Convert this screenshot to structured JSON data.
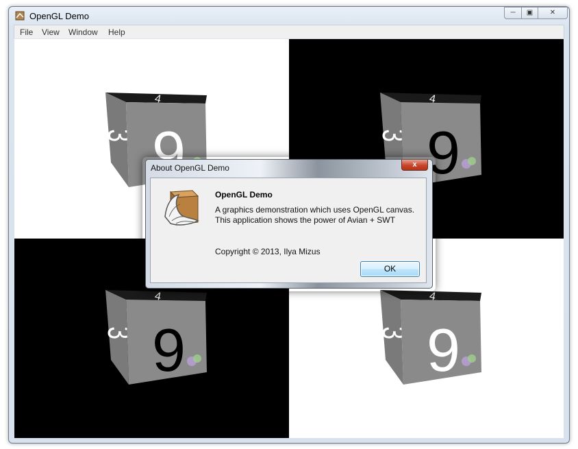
{
  "window": {
    "title": "OpenGL Demo",
    "minimize_glyph": "─",
    "maximize_glyph": "▣",
    "close_glyph": "✕"
  },
  "menu": [
    "File",
    "View",
    "Window",
    "Help"
  ],
  "canvas": {
    "quadrant_colors": [
      "#ffffff",
      "#000000",
      "#000000",
      "#ffffff"
    ],
    "cube_faces": {
      "front": "9",
      "side": "3",
      "top": "4"
    },
    "cube_front_text_colors": [
      "#ffffff",
      "#000000",
      "#000000",
      "#ffffff"
    ]
  },
  "dialog": {
    "title": "About OpenGL Demo",
    "close_glyph": "x",
    "heading": "OpenGL Demo",
    "line1": "A graphics demonstration which uses OpenGL canvas.",
    "line2": "This application shows the power of Avian + SWT",
    "copyright": "Copyright © 2013, Ilya Mizus",
    "ok_label": "OK"
  },
  "colors": {
    "cube_face": "#8a8a8a",
    "ok_border": "#3c7fb1",
    "close_red": "#c8452b"
  }
}
